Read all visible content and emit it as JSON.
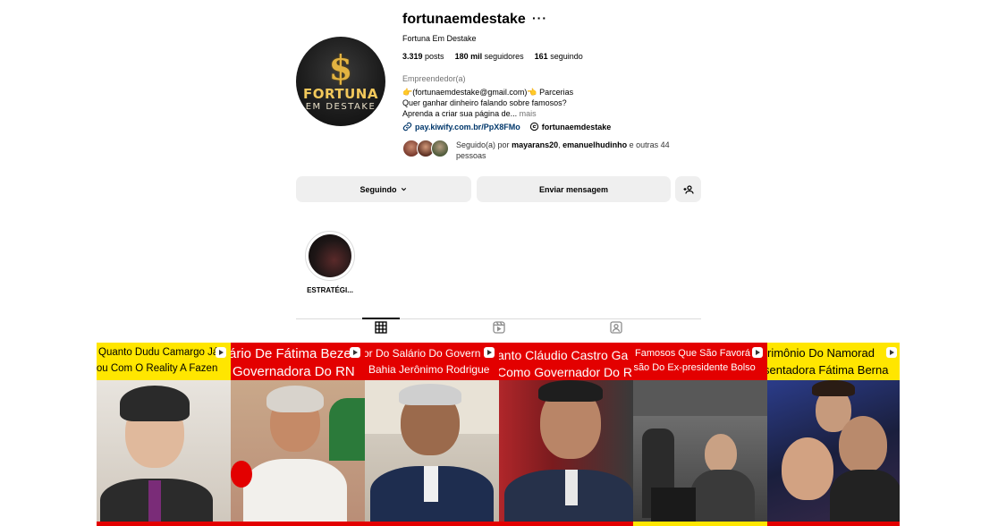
{
  "profile": {
    "username": "fortunaemdestake",
    "more_icon": "more-horizontal-icon",
    "full_name": "Fortuna Em Destake",
    "avatar_text_top": "$",
    "avatar_text_mid": "FORTUNA",
    "avatar_text_bottom": "EM DESTAKE",
    "stats": {
      "posts_value": "3.319",
      "posts_label": "posts",
      "followers_value": "180 mil",
      "followers_label": "seguidores",
      "following_value": "161",
      "following_label": "seguindo"
    },
    "category": "Empreendedor(a)",
    "bio_line1": "👉(fortunaemdestake@gmail.com)👈 Parcerias",
    "bio_line2": "Quer ganhar dinheiro falando sobre famosos?",
    "bio_line3": "Aprenda a criar sua página de...",
    "bio_more": "mais",
    "link": "pay.kiwify.com.br/PpX8FMo",
    "threads_handle": "fortunaemdestake",
    "followed_by_prefix": "Seguido(a) por",
    "followed_by_user1": "mayarans20",
    "followed_by_sep": ",",
    "followed_by_user2": "emanuelhudinho",
    "followed_by_suffix": "e outras 44 pessoas"
  },
  "actions": {
    "following_label": "Seguindo",
    "message_label": "Enviar mensagem"
  },
  "highlights": [
    {
      "label": "ESTRATÉGI..."
    }
  ],
  "tabs": [
    {
      "name": "posts",
      "icon": "grid-icon",
      "active": true
    },
    {
      "name": "reels",
      "icon": "reels-icon",
      "active": false
    },
    {
      "name": "tagged",
      "icon": "tagged-icon",
      "active": false
    }
  ],
  "posts": [
    {
      "line1": "Quanto Dudu Camargo Já",
      "line2": "rou Com O Reality A Fazen",
      "type": "reel"
    },
    {
      "line1": "ário De Fátima Beze",
      "line2": "Governadora Do RN",
      "type": "reel"
    },
    {
      "line1": "or Do Salário Do Govern",
      "line2": "Bahia Jerônimo Rodrigue",
      "type": "reel"
    },
    {
      "line1": "anto Cláudio Castro Ga",
      "line2": "Como Governador Do R",
      "type": "reel"
    },
    {
      "line1": "Famosos Que São Favorá",
      "line2": "isão Do Ex-presidente Bolso",
      "type": "reel"
    },
    {
      "line1": "rimônio Do Namorad",
      "line2": "sentadora Fátima Berna",
      "type": "reel"
    }
  ],
  "colors": {
    "link": "#00376b",
    "button_bg": "#efefef",
    "secondary_text": "#737373",
    "caption_yellow": "#ffe600",
    "caption_red": "#e30000"
  }
}
